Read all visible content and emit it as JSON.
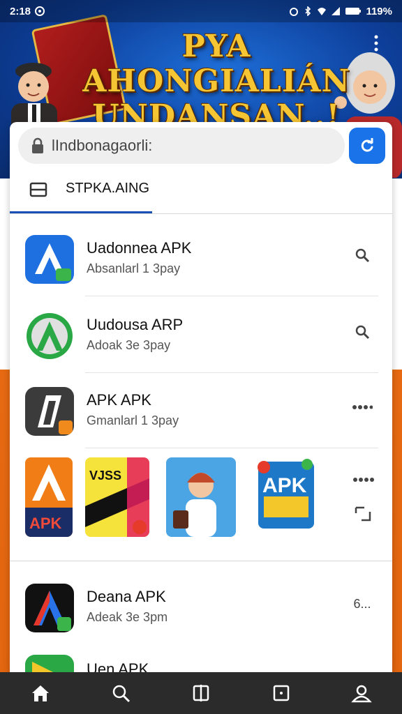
{
  "status_bar": {
    "time": "2:18",
    "battery": "119%"
  },
  "banner": {
    "title_line1": "PYA  AHONGIALIÁN",
    "title_line2": "UNDANSAN..!"
  },
  "search": {
    "value": "lIndbonagaorli:"
  },
  "tab": {
    "label": "STPKA.AING"
  },
  "apps": [
    {
      "name": "Uadonnea APK",
      "subtitle": "Absanlarl 1  3pay",
      "action_icon": "search-icon"
    },
    {
      "name": "Uudousa ARP",
      "subtitle": "Adoak 3e  3pay",
      "action_icon": "search-icon"
    },
    {
      "name": "APK APK",
      "subtitle": "Gmanlarl 1  3pay",
      "action_icon": "more-icon"
    },
    {
      "name": "Deana APK",
      "subtitle": "Adeak 3e  3pm",
      "action_icon": "more-icon"
    },
    {
      "name": "Uen APK",
      "subtitle": "",
      "action_icon": ""
    }
  ],
  "grid": {
    "tile1_label": "APK",
    "tile2_label": "VJSS",
    "tile4_label": "APK",
    "more_count": "6..."
  },
  "colors": {
    "accent": "#1a73e8",
    "banner_blue": "#0d3e99",
    "orange": "#e76a12",
    "nav_bg": "#2b2b2b"
  },
  "nav": {
    "items": [
      "home-icon",
      "search-icon",
      "library-icon",
      "downloads-icon",
      "profile-icon"
    ]
  }
}
